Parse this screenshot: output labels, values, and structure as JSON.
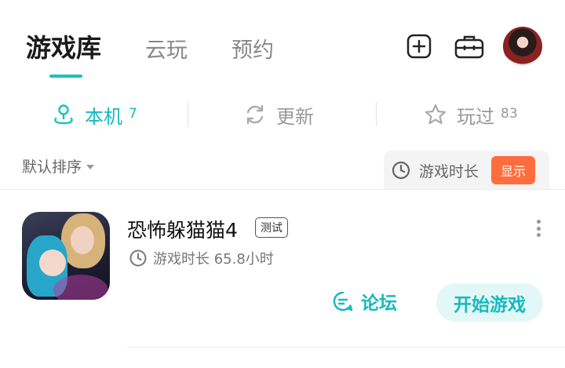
{
  "top_tabs": {
    "library": "游戏库",
    "cloud": "云玩",
    "reserve": "预约"
  },
  "header_icons": [
    "add-icon",
    "toolbox-icon"
  ],
  "sub_tabs": [
    {
      "label": "本机",
      "count": "7",
      "active": true
    },
    {
      "label": "更新",
      "count": "",
      "active": false
    },
    {
      "label": "玩过",
      "count": "83",
      "active": false
    }
  ],
  "sort": {
    "label": "默认排序"
  },
  "duration_filter": {
    "label": "游戏时长",
    "button": "显示"
  },
  "game": {
    "title": "恐怖躲猫猫4",
    "badge": "测试",
    "play_time": "游戏时长 65.8小时",
    "forum": "论坛",
    "start": "开始游戏"
  },
  "colors": {
    "accent": "#17c3c0",
    "show_button": "#ff6d3e",
    "start_bg": "#e3f8f6"
  }
}
